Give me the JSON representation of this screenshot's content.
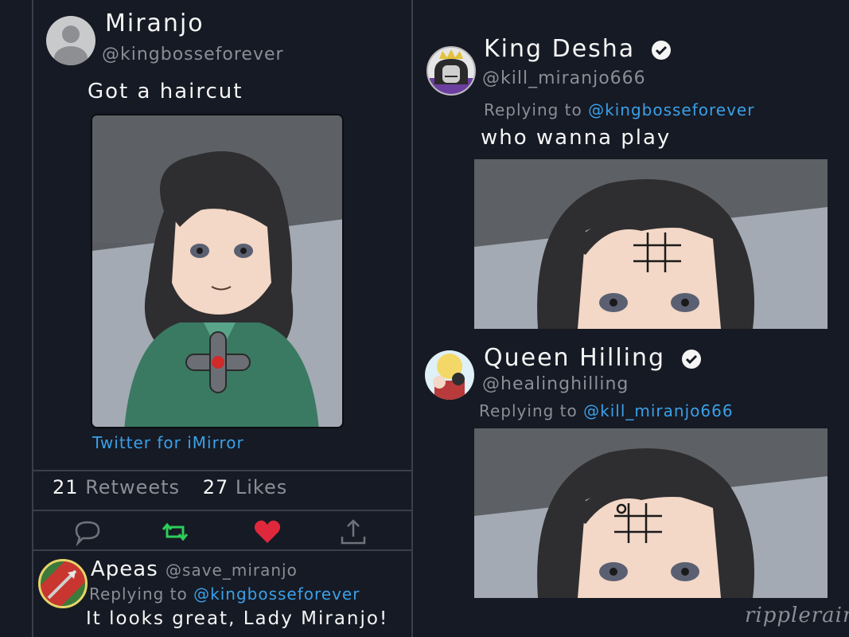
{
  "main_post": {
    "name": "Miranjo",
    "handle": "@kingbosseforever",
    "text": "Got a haircut",
    "client": "Twitter for iMirror",
    "retweets_count": "21",
    "retweets_label": "Retweets",
    "likes_count": "27",
    "likes_label": "Likes"
  },
  "reply_apeas": {
    "name": "Apeas",
    "handle": "@save_miranjo",
    "replying_prefix": "Replying to",
    "replying_to": "@kingbosseforever",
    "text": "It looks great, Lady Miranjo!"
  },
  "reply_desha": {
    "name": "King Desha",
    "handle": "@kill_miranjo666",
    "replying_prefix": "Replying to",
    "replying_to": "@kingbosseforever",
    "text": "who wanna play"
  },
  "reply_hilling": {
    "name": "Queen Hilling",
    "handle": "@healinghilling",
    "replying_prefix": "Replying to",
    "replying_to": "@kill_miranjo666"
  },
  "signature": "ripplerain",
  "colors": {
    "background": "#161a24",
    "link": "#3aa0e8",
    "muted": "#8a8e96",
    "retweet_green": "#2ecc5a",
    "like_red": "#e0283c"
  },
  "icons": [
    "reply-icon",
    "retweet-icon",
    "heart-icon",
    "share-icon",
    "verified-icon"
  ]
}
